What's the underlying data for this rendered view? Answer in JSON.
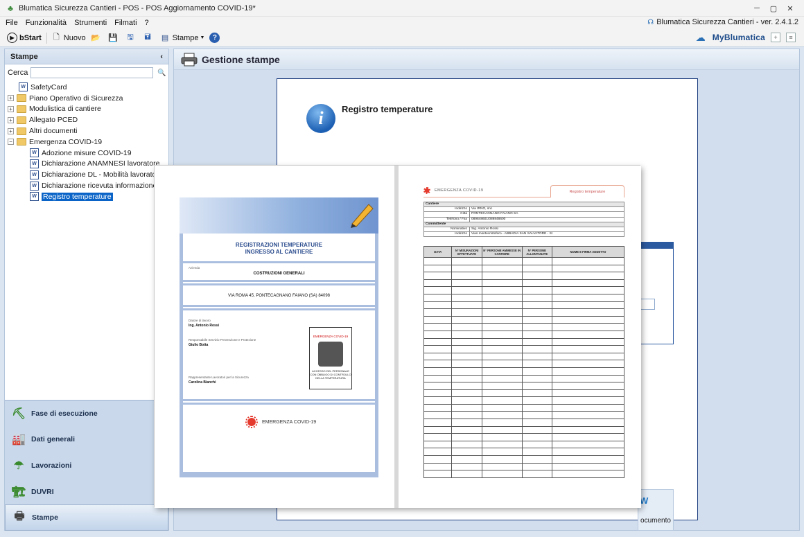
{
  "window": {
    "title": "Blumatica Sicurezza Cantieri - POS - POS Aggiornamento COVID-19*",
    "version": "Blumatica Sicurezza Cantieri - ver. 2.4.1.2"
  },
  "menu": [
    "File",
    "Funzionalità",
    "Strumenti",
    "Filmati",
    "?"
  ],
  "toolbar": {
    "bstart": "bStart",
    "nuovo": "Nuovo",
    "stampe": "Stampe",
    "brand": "MyBlumatica"
  },
  "left": {
    "title": "Stampe",
    "collapse": "‹",
    "search_label": "Cerca",
    "search_value": "",
    "tree": [
      {
        "label": "SafetyCard",
        "type": "doc-special",
        "level": 1,
        "expander": ""
      },
      {
        "label": "Piano Operativo di Sicurezza",
        "type": "folder",
        "level": 0,
        "expander": "+"
      },
      {
        "label": "Modulistica di cantiere",
        "type": "folder",
        "level": 0,
        "expander": "+"
      },
      {
        "label": "Allegato PCED",
        "type": "folder",
        "level": 0,
        "expander": "+"
      },
      {
        "label": "Altri documenti",
        "type": "folder",
        "level": 0,
        "expander": "+"
      },
      {
        "label": "Emergenza COVID-19",
        "type": "folder",
        "level": 0,
        "expander": "−"
      },
      {
        "label": "Adozione misure COVID-19",
        "type": "doc",
        "level": 2,
        "expander": ""
      },
      {
        "label": "Dichiarazione ANAMNESI lavoratore",
        "type": "doc",
        "level": 2,
        "expander": ""
      },
      {
        "label": "Dichiarazione DL - Mobilità lavoratore",
        "type": "doc",
        "level": 2,
        "expander": ""
      },
      {
        "label": "Dichiarazione ricevuta informazione",
        "type": "doc",
        "level": 2,
        "expander": ""
      },
      {
        "label": "Registro temperature",
        "type": "doc",
        "level": 2,
        "expander": "",
        "selected": true
      }
    ],
    "nav": [
      {
        "label": "Fase di esecuzione",
        "icon": "worker-icon"
      },
      {
        "label": "Dati generali",
        "icon": "factory-icon"
      },
      {
        "label": "Lavorazioni",
        "icon": "umbrella-icon"
      },
      {
        "label": "DUVRI",
        "icon": "building-icon"
      },
      {
        "label": "Stampe",
        "icon": "printer-icon",
        "active": true
      }
    ]
  },
  "main": {
    "title": "Gestione stampe",
    "doc_title": "Registro temperature",
    "doc_button": "ocumento"
  },
  "preview": {
    "cover": {
      "title_line1": "REGISTRAZIONI TEMPERATURE",
      "title_line2": "INGRESSO AL CANTIERE",
      "azienda_label": "Azienda",
      "azienda": "COSTRUZIONI GENERALI",
      "address": "VIA ROMA 45, PONTECAGNANO FAIANO (SA) 84098",
      "datore_label": "Datore di lavoro",
      "datore": "Ing. Antonio Rossi",
      "rspp_label": "Responsabile Servizio Prevenzione e Protezione",
      "rspp": "Giulio Botta",
      "rls_label": "Rappresentante Lavoratori per la Sicurezza",
      "rls": "Carolina Bianchi",
      "sign_title": "EMERGENZA COVID-19",
      "sign_text": "ACCESSO DEL PERSONALE CON OBBLIGO DI CONTROLLO DELLA TEMPERATURA",
      "footer": "EMERGENZA COVID-19"
    },
    "register": {
      "header": "EMERGENZA COVID-19",
      "tab": "Registro temperature",
      "cantiere": "Cantiere",
      "rows": [
        {
          "k": "Indirizzo",
          "v": "Via IRNO, snc"
        },
        {
          "k": "Città",
          "v": "PONTECAGNANO FAIANO SA"
        },
        {
          "k": "Telefono / Fax",
          "v": "089848601/089848600"
        }
      ],
      "committente": "Committente",
      "rows2": [
        {
          "k": "Nominativo",
          "v": "Sig. Antonio Rossi"
        },
        {
          "k": "Indirizzo",
          "v": "Vias montecristoforo - ABBADIA SAN SALVATORE - SI"
        }
      ],
      "columns": [
        "DATA",
        "N° MISURAZIONI EFFETTUATE",
        "N° PERSONE AMMESSE IN CANTIERE",
        "N° PERSONE ALLONTANATE",
        "NOME E FIRMA ADDETTO"
      ]
    }
  }
}
